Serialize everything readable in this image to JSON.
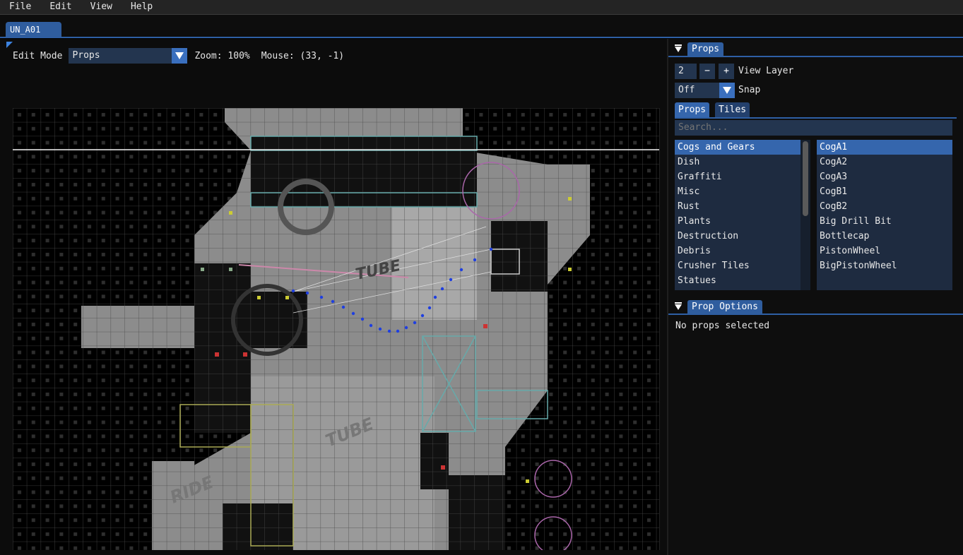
{
  "menu": [
    "File",
    "Edit",
    "View",
    "Help"
  ],
  "document_tab": "UN_A01",
  "toolbar": {
    "edit_mode_label": "Edit Mode",
    "edit_mode_value": "Props",
    "zoom_text": "Zoom: 100%",
    "mouse_text": "Mouse: (33, -1)"
  },
  "canvas": {
    "labels": [
      "TUBE",
      "TUBE",
      "RIDE"
    ]
  },
  "props_panel": {
    "title": "Props",
    "view_layer_value": "2",
    "minus_label": "−",
    "plus_label": "+",
    "view_layer_label": "View Layer",
    "snap_value": "Off",
    "snap_label": "Snap",
    "tabs": [
      "Props",
      "Tiles"
    ],
    "search_placeholder": "Search...",
    "categories": [
      "Cogs and Gears",
      "Dish",
      "Graffiti",
      "Misc",
      "Rust",
      "Plants",
      "Destruction",
      "Debris",
      "Crusher Tiles",
      "Statues"
    ],
    "selected_category": "Cogs and Gears",
    "props": [
      "CogA1",
      "CogA2",
      "CogA3",
      "CogB1",
      "CogB2",
      "Big Drill Bit",
      "Bottlecap",
      "PistonWheel",
      "BigPistonWheel"
    ],
    "selected_prop": "CogA1"
  },
  "prop_options": {
    "title": "Prop Options",
    "status": "No props selected"
  },
  "colors": {
    "accent": "#2f5d9e",
    "selection": "#3566ad",
    "field_bg": "#23354f"
  }
}
